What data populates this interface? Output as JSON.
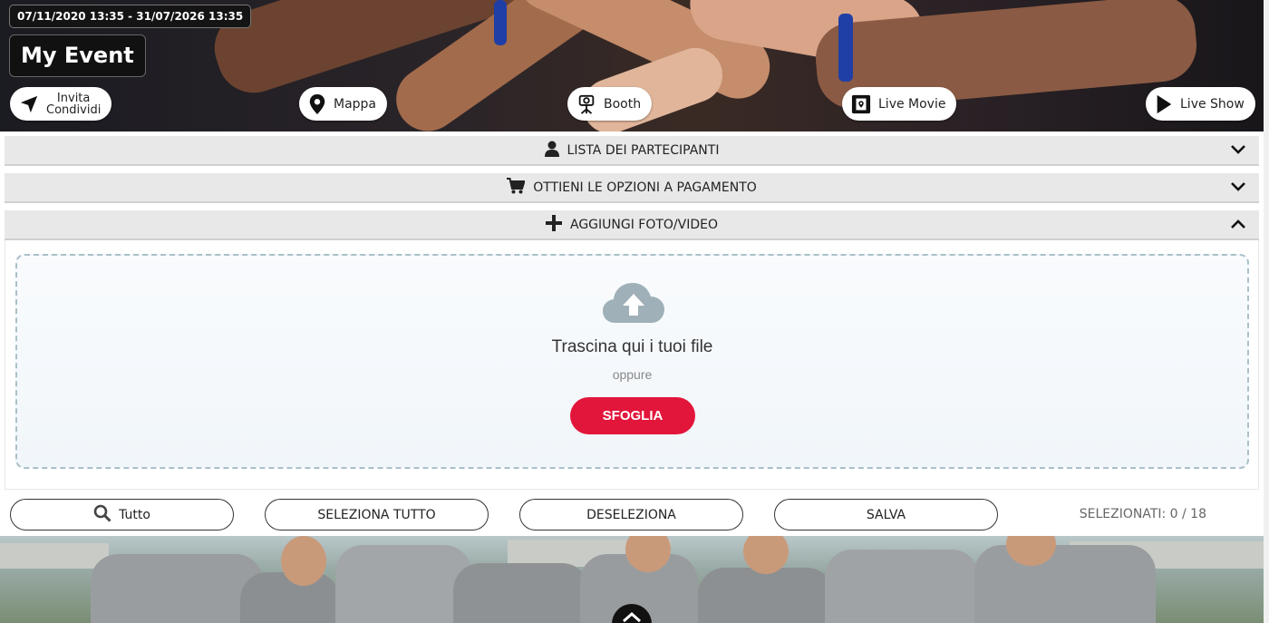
{
  "hero": {
    "date_range": "07/11/2020 13:35 - 31/07/2026 13:35",
    "title": "My Event",
    "buttons": {
      "invite_line1": "Invita",
      "invite_line2": "Condividi",
      "map": "Mappa",
      "booth": "Booth",
      "live_movie": "Live Movie",
      "live_show": "Live Show"
    }
  },
  "panels": {
    "participants": "LISTA DEI PARTECIPANTI",
    "paid_options": "OTTIENI LE OPZIONI A PAGAMENTO",
    "add_media": "AGGIUNGI FOTO/VIDEO"
  },
  "upload": {
    "drop_text": "Trascina qui i tuoi file",
    "or_text": "oppure",
    "browse_label": "SFOGLIA"
  },
  "toolbar": {
    "filter_label": "Tutto",
    "select_all": "SELEZIONA TUTTO",
    "deselect": "DESELEZIONA",
    "save": "SALVA",
    "selected_label": "SELEZIONATI: 0 / 18"
  },
  "colors": {
    "accent": "#e2163b",
    "panel_bg": "#e8e8e8",
    "dropzone_border": "#aac0c8",
    "upload_icon": "#9fb0b8"
  },
  "icons": {
    "invite": "paper-plane-icon",
    "map": "map-pin-icon",
    "booth": "camera-tripod-icon",
    "live_movie": "film-icon",
    "live_show": "play-icon",
    "participants": "user-icon",
    "paid_options": "cart-icon",
    "add_media": "plus-icon",
    "upload": "cloud-upload-icon",
    "search": "search-icon",
    "scroll_top": "chevron-up-icon"
  }
}
